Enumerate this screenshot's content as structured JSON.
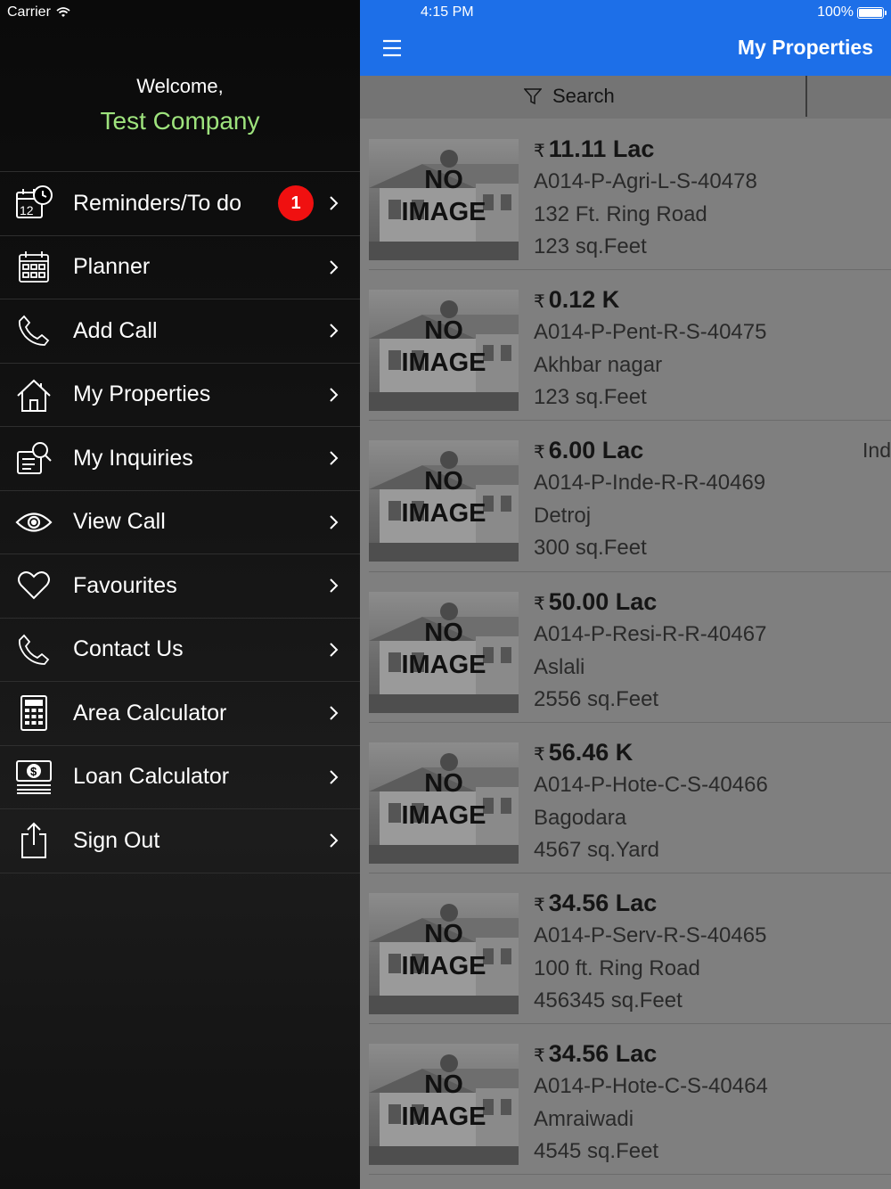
{
  "status_bar": {
    "carrier": "Carrier",
    "time": "4:15 PM",
    "battery": "100%"
  },
  "drawer": {
    "welcome": "Welcome,",
    "company": "Test Company",
    "items": [
      {
        "label": "Reminders/To do",
        "icon": "calendar-clock-icon",
        "badge": "1"
      },
      {
        "label": "Planner",
        "icon": "planner-calendar-icon"
      },
      {
        "label": "Add Call",
        "icon": "phone-icon"
      },
      {
        "label": "My Properties",
        "icon": "home-icon"
      },
      {
        "label": "My Inquiries",
        "icon": "inquiry-icon"
      },
      {
        "label": "View Call",
        "icon": "eye-icon"
      },
      {
        "label": "Favourites",
        "icon": "heart-icon"
      },
      {
        "label": "Contact Us",
        "icon": "phone-icon"
      },
      {
        "label": "Area Calculator",
        "icon": "calculator-icon"
      },
      {
        "label": "Loan Calculator",
        "icon": "money-icon"
      },
      {
        "label": "Sign Out",
        "icon": "share-out-icon"
      }
    ]
  },
  "navbar": {
    "title": "My Properties",
    "menu_icon": "hamburger-icon"
  },
  "search": {
    "label": "Search",
    "icon": "filter-icon"
  },
  "properties": [
    {
      "price": "11.11 Lac",
      "code": "A014-P-Agri-L-S-40478",
      "location": "132 Ft. Ring Road",
      "area": "123 sq.Feet",
      "tag": ""
    },
    {
      "price": "0.12 K",
      "code": "A014-P-Pent-R-S-40475",
      "location": "Akhbar nagar",
      "area": "123 sq.Feet",
      "tag": ""
    },
    {
      "price": "6.00 Lac",
      "code": "A014-P-Inde-R-R-40469",
      "location": "Detroj",
      "area": "300 sq.Feet",
      "tag": "Ind"
    },
    {
      "price": "50.00 Lac",
      "code": "A014-P-Resi-R-R-40467",
      "location": "Aslali",
      "area": "2556 sq.Feet",
      "tag": ""
    },
    {
      "price": "56.46 K",
      "code": "A014-P-Hote-C-S-40466",
      "location": "Bagodara",
      "area": "4567 sq.Yard",
      "tag": ""
    },
    {
      "price": "34.56 Lac",
      "code": "A014-P-Serv-R-S-40465",
      "location": "100 ft. Ring Road",
      "area": "456345 sq.Feet",
      "tag": ""
    },
    {
      "price": "34.56 Lac",
      "code": "A014-P-Hote-C-S-40464",
      "location": "Amraiwadi",
      "area": "4545 sq.Feet",
      "tag": ""
    }
  ],
  "placeholder_image": {
    "line1": "NO",
    "line2": "IMAGE"
  },
  "currency_symbol": "₹",
  "colors": {
    "navbar": "#1d6fe8",
    "company": "#9ee37d",
    "badge": "#f01010"
  }
}
